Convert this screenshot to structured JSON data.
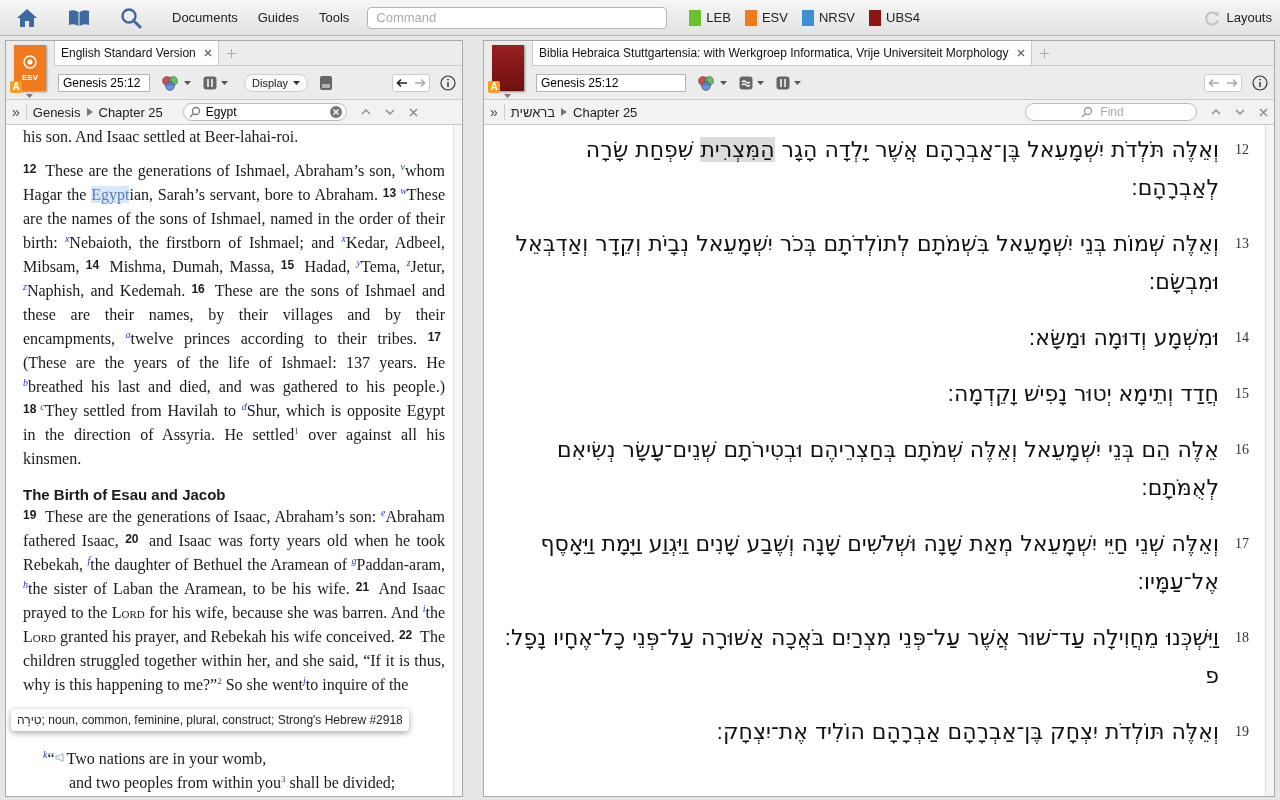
{
  "toolbar": {
    "menus": [
      "Documents",
      "Guides",
      "Tools"
    ],
    "command": {
      "placeholder": "Command"
    },
    "resources": [
      {
        "label": "LEB",
        "color": "#6cbf2e"
      },
      {
        "label": "ESV",
        "color": "#f07a1e"
      },
      {
        "label": "NRSV",
        "color": "#3b8fd6"
      },
      {
        "label": "UBS4",
        "color": "#8e1414"
      }
    ],
    "layouts": "Layouts"
  },
  "left_panel": {
    "expand": "»",
    "cover_label": "ESV",
    "badge": "A",
    "tab": "English Standard Version",
    "reference": "Genesis 25:12",
    "display": "Display",
    "breadcrumb": [
      "Genesis",
      "Chapter 25"
    ],
    "find": {
      "value": "Egypt"
    },
    "content": [
      {
        "kind": "paragraph",
        "runs": [
          {
            "kind": "text",
            "text": "his son. And Isaac settled at Beer-lahai-roi."
          }
        ]
      },
      {
        "kind": "paragraph",
        "runs": [
          {
            "kind": "verse",
            "text": "12"
          },
          {
            "kind": "text",
            "text": " These are the generations of Ishmael, Abraham’s son, "
          },
          {
            "kind": "note",
            "text": "v"
          },
          {
            "kind": "text",
            "text": "whom Hagar the "
          },
          {
            "kind": "highlight",
            "text": "Egypt"
          },
          {
            "kind": "text",
            "text": "ian, Sarah’s servant, bore to Abraham. "
          },
          {
            "kind": "verse",
            "text": "13"
          },
          {
            "kind": "note",
            "text": "w"
          },
          {
            "kind": "text",
            "text": "These are the names of the sons of Ishmael, named in the order of their birth: "
          },
          {
            "kind": "note",
            "text": "x"
          },
          {
            "kind": "text",
            "text": "Nebaioth, the firstborn of Ishmael; and "
          },
          {
            "kind": "note",
            "text": "x"
          },
          {
            "kind": "text",
            "text": "Kedar, Adbeel, Mibsam, "
          },
          {
            "kind": "verse",
            "text": "14"
          },
          {
            "kind": "text",
            "text": " Mishma, Dumah, Massa, "
          },
          {
            "kind": "verse",
            "text": "15"
          },
          {
            "kind": "text",
            "text": " Hadad, "
          },
          {
            "kind": "note",
            "text": "y"
          },
          {
            "kind": "text",
            "text": "Tema, "
          },
          {
            "kind": "note",
            "text": "z"
          },
          {
            "kind": "text",
            "text": "Jetur, "
          },
          {
            "kind": "note",
            "text": "z"
          },
          {
            "kind": "text",
            "text": "Naphish, and Kedemah. "
          },
          {
            "kind": "verse",
            "text": "16"
          },
          {
            "kind": "text",
            "text": " These are the sons of Ishmael and these are their names, by their villages and by their encampments, "
          },
          {
            "kind": "note",
            "text": "a"
          },
          {
            "kind": "text",
            "text": "twelve princes according to their tribes. "
          },
          {
            "kind": "verse",
            "text": "17"
          },
          {
            "kind": "text",
            "text": " (These are the years of the life of Ishmael: 137 years. He "
          },
          {
            "kind": "note",
            "text": "b"
          },
          {
            "kind": "text",
            "text": "breathed his last and died, and was gathered to his people.) "
          },
          {
            "kind": "verse",
            "text": "18"
          },
          {
            "kind": "note",
            "text": "c"
          },
          {
            "kind": "text",
            "text": "They settled from Havilah to "
          },
          {
            "kind": "note",
            "text": "d"
          },
          {
            "kind": "text",
            "text": "Shur, which is opposite Egypt in the direction of Assyria. He settled"
          },
          {
            "kind": "footnote",
            "text": "1"
          },
          {
            "kind": "text",
            "text": " over against all his kinsmen."
          }
        ]
      },
      {
        "kind": "heading",
        "text": "The Birth of Esau and Jacob"
      },
      {
        "kind": "paragraph",
        "runs": [
          {
            "kind": "verse",
            "text": "19"
          },
          {
            "kind": "text",
            "text": " These are the generations of Isaac, Abraham’s son: "
          },
          {
            "kind": "note",
            "text": "e"
          },
          {
            "kind": "text",
            "text": "Abraham fathered Isaac, "
          },
          {
            "kind": "verse",
            "text": "20"
          },
          {
            "kind": "text",
            "text": " and Isaac was forty years old when he took Rebekah, "
          },
          {
            "kind": "note",
            "text": "f"
          },
          {
            "kind": "text",
            "text": "the daughter of Bethuel the Aramean of "
          },
          {
            "kind": "note",
            "text": "g"
          },
          {
            "kind": "text",
            "text": "Paddan-aram, "
          },
          {
            "kind": "note",
            "text": "h"
          },
          {
            "kind": "text",
            "text": "the sister of Laban the Aramean, to be his wife. "
          },
          {
            "kind": "verse",
            "text": "21"
          },
          {
            "kind": "text",
            "text": " And Isaac prayed to the "
          },
          {
            "kind": "lord",
            "text": "Lord"
          },
          {
            "kind": "text",
            "text": " for his wife, because she was barren. And "
          },
          {
            "kind": "note",
            "text": "i"
          },
          {
            "kind": "text",
            "text": "the "
          },
          {
            "kind": "lord",
            "text": "Lord"
          },
          {
            "kind": "text",
            "text": " granted his prayer, and Rebekah his wife conceived. "
          },
          {
            "kind": "verse",
            "text": "22"
          },
          {
            "kind": "text",
            "text": " The children struggled together within her, and she said, “If it is thus, why is this happening to me?”"
          },
          {
            "kind": "footnote",
            "text": "2"
          },
          {
            "kind": "text",
            "text": " So she went"
          },
          {
            "kind": "note",
            "text": "j"
          },
          {
            "kind": "text",
            "text": "to inquire of the"
          }
        ]
      },
      {
        "kind": "tooltip",
        "text": "טִירָה; noun, common, feminine, plural, construct; Strong's Hebrew #2918"
      },
      {
        "kind": "poetry",
        "lines": [
          {
            "indented": false,
            "runs": [
              {
                "kind": "note",
                "text": "k"
              },
              {
                "kind": "text",
                "text": "“"
              },
              {
                "kind": "audio"
              },
              {
                "kind": "text",
                "text": "Two nations are in your womb,"
              }
            ]
          },
          {
            "indented": true,
            "runs": [
              {
                "kind": "text",
                "text": "and two peoples from within you"
              },
              {
                "kind": "footnote",
                "text": "3"
              },
              {
                "kind": "text",
                "text": " shall be divided;"
              }
            ]
          }
        ]
      }
    ]
  },
  "right_panel": {
    "expand": "»",
    "badge": "A",
    "tab": "Biblia Hebraica Stuttgartensia: with Werkgroep Informatica, Vrije Universiteit Morphology",
    "reference": "Genesis 25:12",
    "breadcrumb": [
      "בראשית",
      "Chapter 25"
    ],
    "find": {
      "placeholder": "Find"
    },
    "verses": [
      {
        "number": "12",
        "segments": [
          {
            "text": "וְאֵלֶּה תֹּלְדֹת יִשְׁמָעֵאל בֶּן־אַבְרָהָם אֲשֶׁר יָלְדָה הָגָר ",
            "highlighted": false
          },
          {
            "text": "הַמִּצְרִית",
            "highlighted": true
          },
          {
            "text": " שִׁפְחַת שָׂרָה לְאַבְרָהָם׃",
            "highlighted": false
          }
        ]
      },
      {
        "number": "13",
        "segments": [
          {
            "text": "וְאֵלֶּה שְׁמוֹת בְּנֵי יִשְׁמָעֵאל בִּשְׁמֹתָם לְתוֹלְדֹתָם בְּכֹר יִשְׁמָעֵאל נְבָיֹת וְקֵדָר וְאַדְבְּאֵל וּמִבְשָׂם׃",
            "highlighted": false
          }
        ]
      },
      {
        "number": "14",
        "segments": [
          {
            "text": "וּמִשְׁמָע וְדוּמָה וּמַשָּׂא׃",
            "highlighted": false
          }
        ]
      },
      {
        "number": "15",
        "segments": [
          {
            "text": "חֲדַד וְתֵימָא יְטוּר נָפִישׁ וָקֵדְמָה׃",
            "highlighted": false
          }
        ]
      },
      {
        "number": "16",
        "segments": [
          {
            "text": "אֵלֶּה הֵם בְּנֵי יִשְׁמָעֵאל וְאֵלֶּה שְׁמֹתָם בְּחַצְרֵיהֶם וּבְטִירֹתָם שְׁנֵים־עָשָׂר נְשִׂיאִם לְאֻמֹּתָם׃",
            "highlighted": false
          }
        ]
      },
      {
        "number": "17",
        "segments": [
          {
            "text": "וְאֵלֶּה שְׁנֵי חַיֵּי יִשְׁמָעֵאל מְאַת שָׁנָה וּשְׁלֹשִׁים שָׁנָה וְשֶׁבַע שָׁנִים וַיִּגְוַע וַיָּמָת וַיֵּאָסֶף אֶל־עַמָּיו׃",
            "highlighted": false
          }
        ]
      },
      {
        "number": "18",
        "segments": [
          {
            "text": "וַיִּשְׁכְּנוּ מֵחֲוִילָה עַד־שׁוּר אֲשֶׁר עַל־פְּנֵי מִצְרַיִם בֹּאֲכָה אַשּׁוּרָה עַל־פְּנֵי כָל־אֶחָיו נָפָל׃ פ",
            "highlighted": false
          }
        ]
      },
      {
        "number": "19",
        "segments": [
          {
            "text": "וְאֵלֶּה תּוֹלְדֹת יִצְחָק בֶּן־אַבְרָהָם אַבְרָהָם הוֹלִיד אֶת־יִצְחָק׃",
            "highlighted": false
          }
        ]
      }
    ]
  }
}
